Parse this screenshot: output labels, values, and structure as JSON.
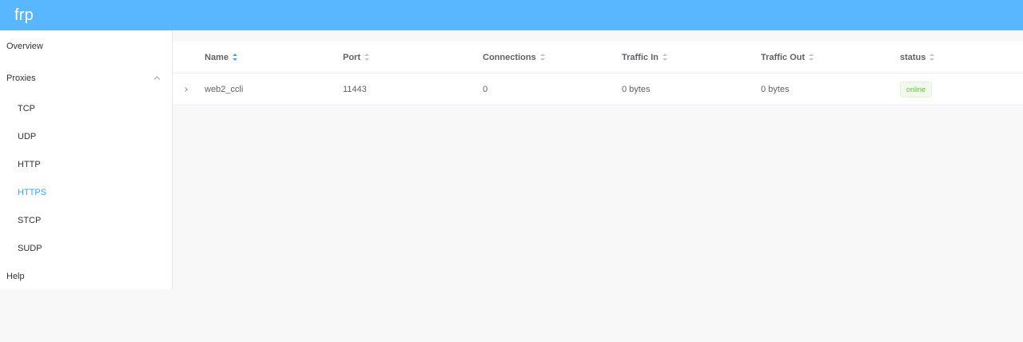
{
  "app": {
    "title": "frp"
  },
  "sidebar": {
    "items": [
      {
        "label": "Overview"
      },
      {
        "label": "Proxies"
      },
      {
        "label": "TCP"
      },
      {
        "label": "UDP"
      },
      {
        "label": "HTTP"
      },
      {
        "label": "HTTPS"
      },
      {
        "label": "STCP"
      },
      {
        "label": "SUDP"
      },
      {
        "label": "Help"
      }
    ],
    "active": "HTTPS"
  },
  "table": {
    "headers": {
      "name": "Name",
      "port": "Port",
      "connections": "Connections",
      "traffic_in": "Traffic In",
      "traffic_out": "Traffic Out",
      "status": "status"
    },
    "sorted_column": "name",
    "rows": [
      {
        "name": "web2_ccli",
        "port": "11443",
        "connections": "0",
        "traffic_in": "0 bytes",
        "traffic_out": "0 bytes",
        "status": "online"
      }
    ]
  },
  "colors": {
    "header_bg": "#58b7ff",
    "active_menu": "#409eff",
    "status_online": "#67c23a"
  }
}
